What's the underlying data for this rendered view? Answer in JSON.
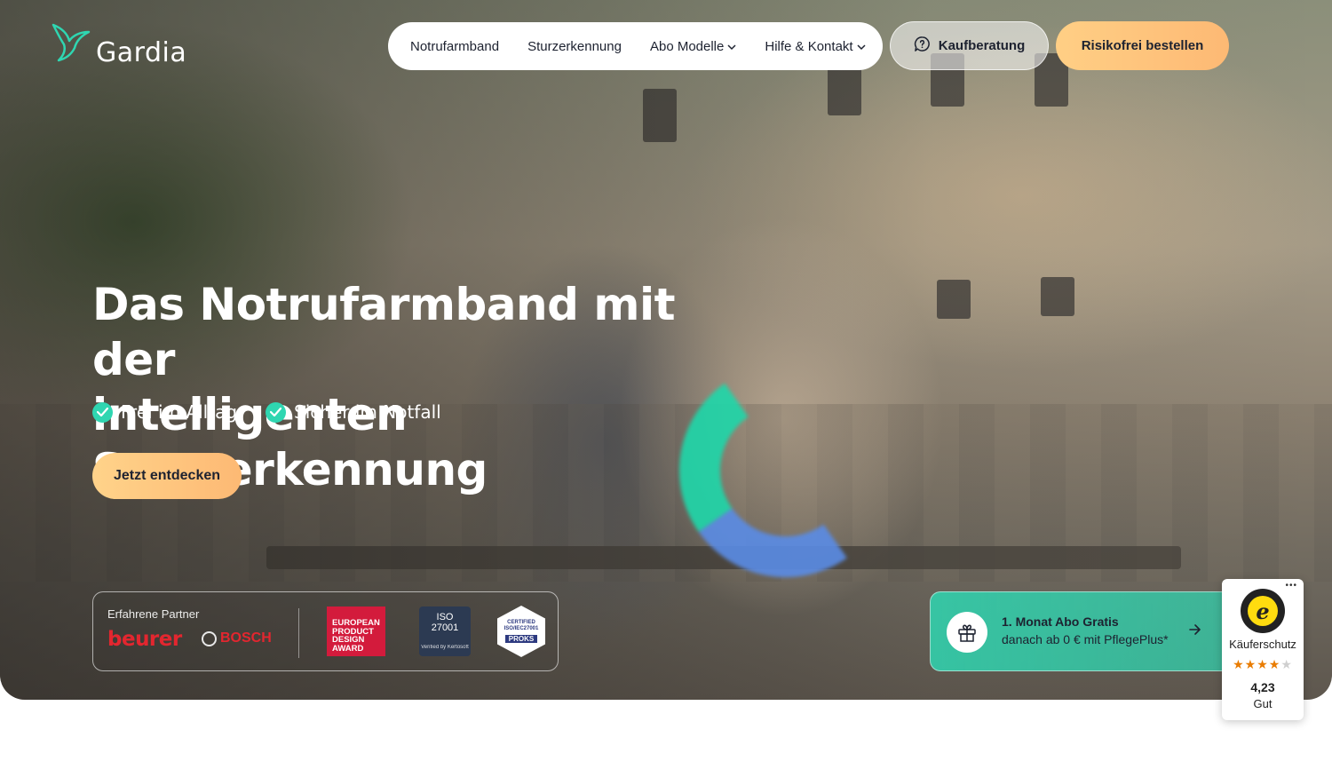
{
  "brand": {
    "name": "Gardia",
    "accent": "#2fd6b1",
    "cta_gradient": [
      "#ffd38a",
      "#fdb974"
    ]
  },
  "nav": {
    "items": [
      {
        "label": "Notrufarmband",
        "has_dropdown": false
      },
      {
        "label": "Sturzerkennung",
        "has_dropdown": false
      },
      {
        "label": "Abo Modelle",
        "has_dropdown": true
      },
      {
        "label": "Hilfe & Kontakt",
        "has_dropdown": true
      }
    ],
    "advice_label": "Kaufberatung",
    "advice_icon": "chat-question-icon",
    "order_label": "Risikofrei bestellen"
  },
  "hero": {
    "headline_line1": "Das Notrufarmband mit der",
    "headline_line2": "intelligenten Sturzerkennung",
    "features": [
      "Frei im Alltag",
      "Sicher im Notfall"
    ],
    "cta_label": "Jetzt entdecken"
  },
  "partners": {
    "label": "Erfahrene Partner",
    "logos": {
      "beurer": "beurer",
      "bosch": "BOSCH",
      "award_lines": [
        "EUROPEAN",
        "PRODUCT",
        "DESIGN",
        "AWARD"
      ],
      "iso_lines": [
        "ISO",
        "27001"
      ],
      "iso_footer": "Verified by Kertosoft",
      "proks_top": "CERTIFIED ISO/IEC27001",
      "proks_main": "PROKS"
    }
  },
  "promo": {
    "title": "1. Monat Abo Gratis",
    "subtitle": "danach ab 0 € mit PflegePlus*",
    "icon": "gift-icon"
  },
  "trusted_shops": {
    "label": "Käuferschutz",
    "rating": 4.23,
    "rating_text": "4,23",
    "grade": "Gut",
    "stars_filled": 4,
    "stars_total": 5
  }
}
